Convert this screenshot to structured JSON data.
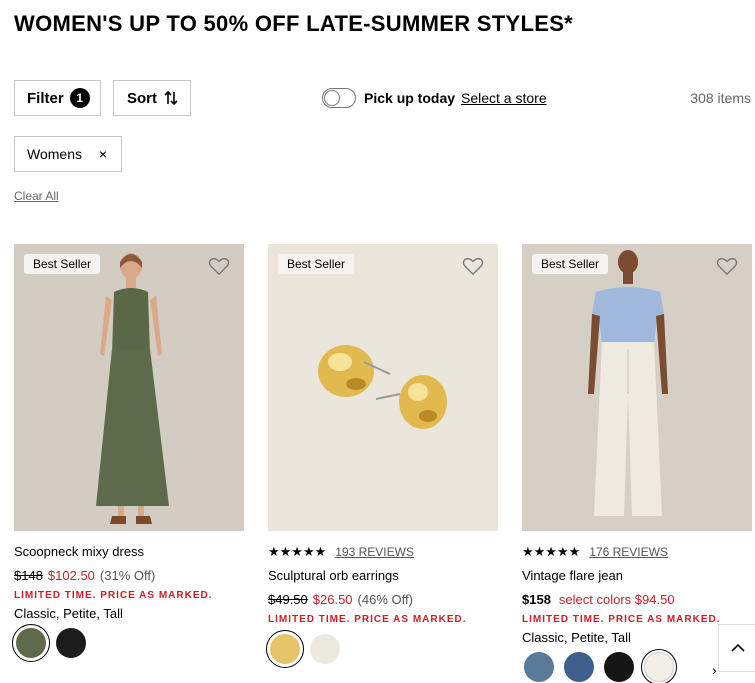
{
  "page_title": "WOMEN'S UP TO 50% OFF LATE-SUMMER STYLES*",
  "toolbar": {
    "filter_label": "Filter",
    "filter_count": "1",
    "sort_label": "Sort",
    "pickup_label": "Pick up today",
    "select_store": "Select a store",
    "item_count": "308 items"
  },
  "active_filters": {
    "chip_label": "Womens",
    "chip_remove": "×",
    "clear_all": "Clear All"
  },
  "products": [
    {
      "badge": "Best Seller",
      "name": "Scoopneck mixy dress",
      "original_price": "$148",
      "sale_price": "$102.50",
      "discount": "(31% Off)",
      "promo": "LIMITED TIME. PRICE AS MARKED.",
      "sizes": "Classic, Petite, Tall",
      "swatches": [
        "#5d6a4b",
        "#1c1c1c"
      ]
    },
    {
      "badge": "Best Seller",
      "stars": "★★★★★",
      "reviews": "193 REVIEWS",
      "name": "Sculptural orb earrings",
      "original_price": "$49.50",
      "sale_price": "$26.50",
      "discount": "(46% Off)",
      "promo": "LIMITED TIME. PRICE AS MARKED.",
      "swatches": [
        "#e5c46a",
        "#ece9df"
      ]
    },
    {
      "badge": "Best Seller",
      "stars": "★★★★★",
      "reviews": "176 REVIEWS",
      "name": "Vintage flare jean",
      "price": "$158",
      "sale_price": "select colors $94.50",
      "promo": "LIMITED TIME. PRICE AS MARKED.",
      "sizes": "Classic, Petite, Tall",
      "swatches": [
        "#5a7a9a",
        "#3d5f8c",
        "#151515",
        "#f2efe6"
      ],
      "more_arrow": "›"
    }
  ],
  "colors": {
    "sale_red": "#c8202b",
    "border_gray": "#c8c8c8"
  }
}
